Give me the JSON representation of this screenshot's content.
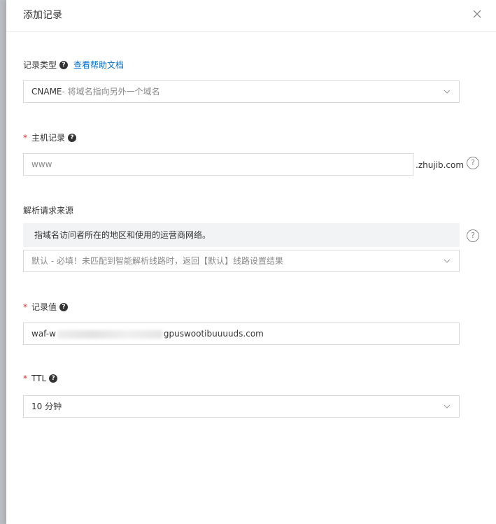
{
  "dialog": {
    "title": "添加记录",
    "close_icon": "close-icon"
  },
  "record_type": {
    "label": "记录类型",
    "help_link": "查看帮助文档",
    "value_main": "CNAME",
    "value_desc": "- 将域名指向另外一个域名"
  },
  "host_record": {
    "label": "主机记录",
    "value": "www",
    "suffix": ".zhujib.com"
  },
  "source": {
    "label": "解析请求来源",
    "tooltip": "指域名访问者所在的地区和使用的运营商网络。",
    "value_main": "默认",
    "value_desc": " - 必填！未匹配到智能解析线路时，返回【默认】线路设置结果"
  },
  "record_value": {
    "label": "记录值",
    "value_start": "waf-w",
    "value_end": "gpuswootibuuuuds.com"
  },
  "ttl": {
    "label": "TTL",
    "value": "10 分钟"
  },
  "colors": {
    "link": "#0070cc",
    "required": "#d93026",
    "border": "#d7d8d9"
  }
}
